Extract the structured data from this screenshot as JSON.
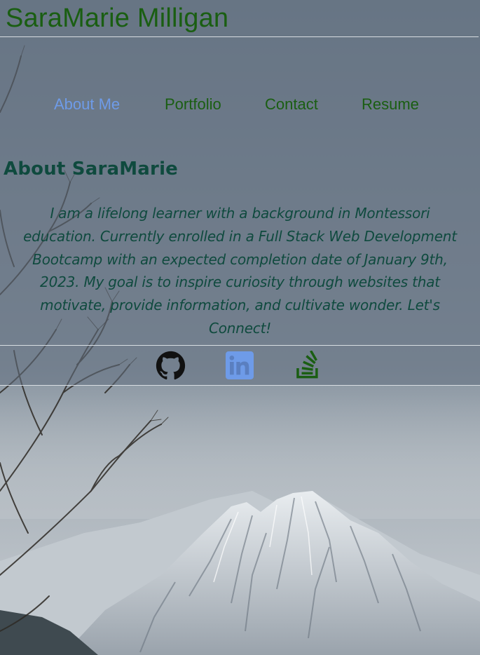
{
  "header": {
    "title": "SaraMarie Milligan"
  },
  "nav": {
    "items": [
      {
        "label": "About Me",
        "active": true
      },
      {
        "label": "Portfolio",
        "active": false
      },
      {
        "label": "Contact",
        "active": false
      },
      {
        "label": "Resume",
        "active": false
      }
    ]
  },
  "about": {
    "heading": "About SaraMarie",
    "bio": "I am a lifelong learner with a background in Montessori education. Currently enrolled in a Full Stack Web Development Bootcamp with an expected completion date of January 9th, 2023. My goal is to inspire curiosity through websites that motivate, provide information, and cultivate wonder. Let's Connect!"
  },
  "footer": {
    "social": [
      {
        "icon": "github-icon",
        "color": "#111111"
      },
      {
        "icon": "linkedin-icon",
        "color": "#6e9be8"
      },
      {
        "icon": "stack-overflow-icon",
        "color": "#1a5e12"
      }
    ]
  },
  "colors": {
    "title_green": "#1a5e12",
    "nav_active": "#6e9be8",
    "text_teal": "#0f4a3e",
    "rule": "#d8dde2"
  }
}
